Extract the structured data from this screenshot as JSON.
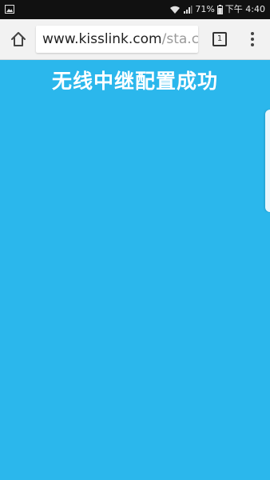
{
  "status_bar": {
    "battery_percent": "71%",
    "time": "下午 4:40"
  },
  "browser": {
    "url_domain": "www.kisslink.com",
    "url_path": "/sta.cgi",
    "tab_count": "1"
  },
  "page": {
    "title": "无线中继配置成功",
    "background_color": "#2bb7ec"
  },
  "icons": {
    "status_left": "image-icon",
    "wifi": "wifi-icon",
    "signal": "signal-icon",
    "battery": "battery-icon",
    "home": "home-icon",
    "tabs": "tabs-icon",
    "menu": "more-vert-icon"
  }
}
